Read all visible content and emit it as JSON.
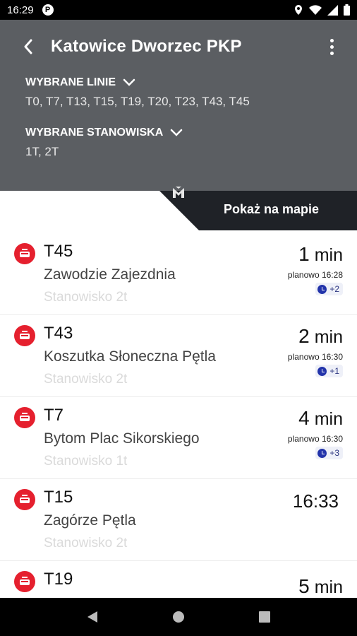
{
  "status_bar": {
    "time": "16:29",
    "left_icon": "P",
    "icons": [
      "location-icon",
      "wifi-icon",
      "signal-icon",
      "battery-icon"
    ]
  },
  "header": {
    "title": "Katowice Dworzec PKP",
    "lines_label": "WYBRANE LINIE",
    "lines_value": "T0, T7, T13, T15, T19, T20, T23, T43, T45",
    "stands_label": "WYBRANE STANOWISKA",
    "stands_value": "1T, 2T",
    "background_color": "#5b5e62"
  },
  "map_button": {
    "label": "Pokaż na mapie",
    "color": "#1f2227"
  },
  "departures": [
    {
      "line": "T45",
      "destination": "Zawodzie Zajezdnia",
      "stop": "Stanowisko 2t",
      "eta_num": "1",
      "eta_unit": "min",
      "planned": "planowo 16:28",
      "delay": "+2"
    },
    {
      "line": "T43",
      "destination": "Koszutka Słoneczna Pętla",
      "stop": "Stanowisko 2t",
      "eta_num": "2",
      "eta_unit": "min",
      "planned": "planowo 16:30",
      "delay": "+1"
    },
    {
      "line": "T7",
      "destination": "Bytom Plac Sikorskiego",
      "stop": "Stanowisko 1t",
      "eta_num": "4",
      "eta_unit": "min",
      "planned": "planowo 16:30",
      "delay": "+3"
    },
    {
      "line": "T15",
      "destination": "Zagórze Pętla",
      "stop": "Stanowisko 2t",
      "eta_time": "16:33"
    },
    {
      "line": "T19",
      "eta_num": "5",
      "eta_unit": "min"
    }
  ],
  "colors": {
    "tram_icon": "#e5202e",
    "delay_badge": "#2233aa"
  }
}
